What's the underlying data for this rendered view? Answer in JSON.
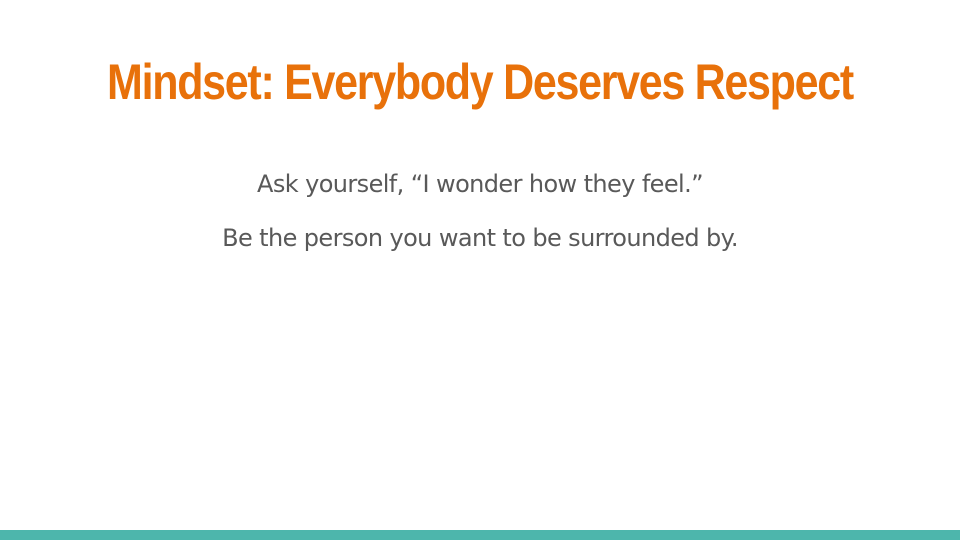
{
  "slide": {
    "title": "Mindset: Everybody Deserves Respect",
    "lines": [
      "Ask yourself, “I wonder how they feel.”",
      "Be the person you want to be surrounded by."
    ]
  },
  "colors": {
    "title": "#e8710a",
    "body_text": "#595959",
    "footer_bar": "#4db6ac",
    "background": "#ffffff"
  }
}
